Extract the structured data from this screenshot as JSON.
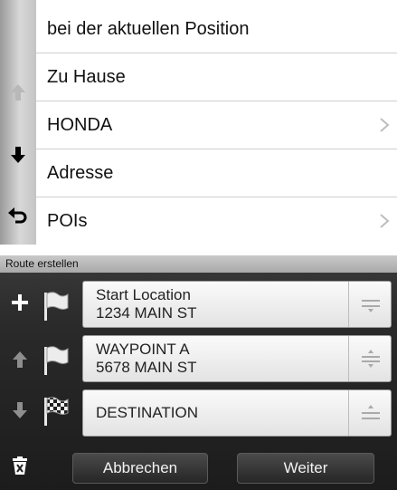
{
  "menu": {
    "items": [
      {
        "label": "bei der aktuellen Position",
        "chevron": false
      },
      {
        "label": "Zu Hause",
        "chevron": false
      },
      {
        "label": "HONDA",
        "chevron": true
      },
      {
        "label": "Adresse",
        "chevron": false
      },
      {
        "label": "POIs",
        "chevron": true
      }
    ],
    "side_icons": [
      "arrow-up-icon",
      "arrow-down-icon",
      "back-icon"
    ]
  },
  "route": {
    "header": "Route erstellen",
    "side_icons": [
      "plus-icon",
      "arrow-up-icon",
      "arrow-down-icon",
      "trash-icon"
    ],
    "waypoints": [
      {
        "name": "Start Location",
        "address": "1234 MAIN ST",
        "flag": "flag-icon"
      },
      {
        "name": "WAYPOINT A",
        "address": "5678 MAIN ST",
        "flag": "flag-icon"
      },
      {
        "name": "DESTINATION",
        "address": "",
        "flag": "checkered-flag-icon"
      }
    ],
    "cancel_label": "Abbrechen",
    "next_label": "Weiter"
  },
  "colors": {
    "accent_text": "#111111",
    "panel_dark": "#1c1c1c",
    "disabled_icon": "#9a9a9a"
  }
}
